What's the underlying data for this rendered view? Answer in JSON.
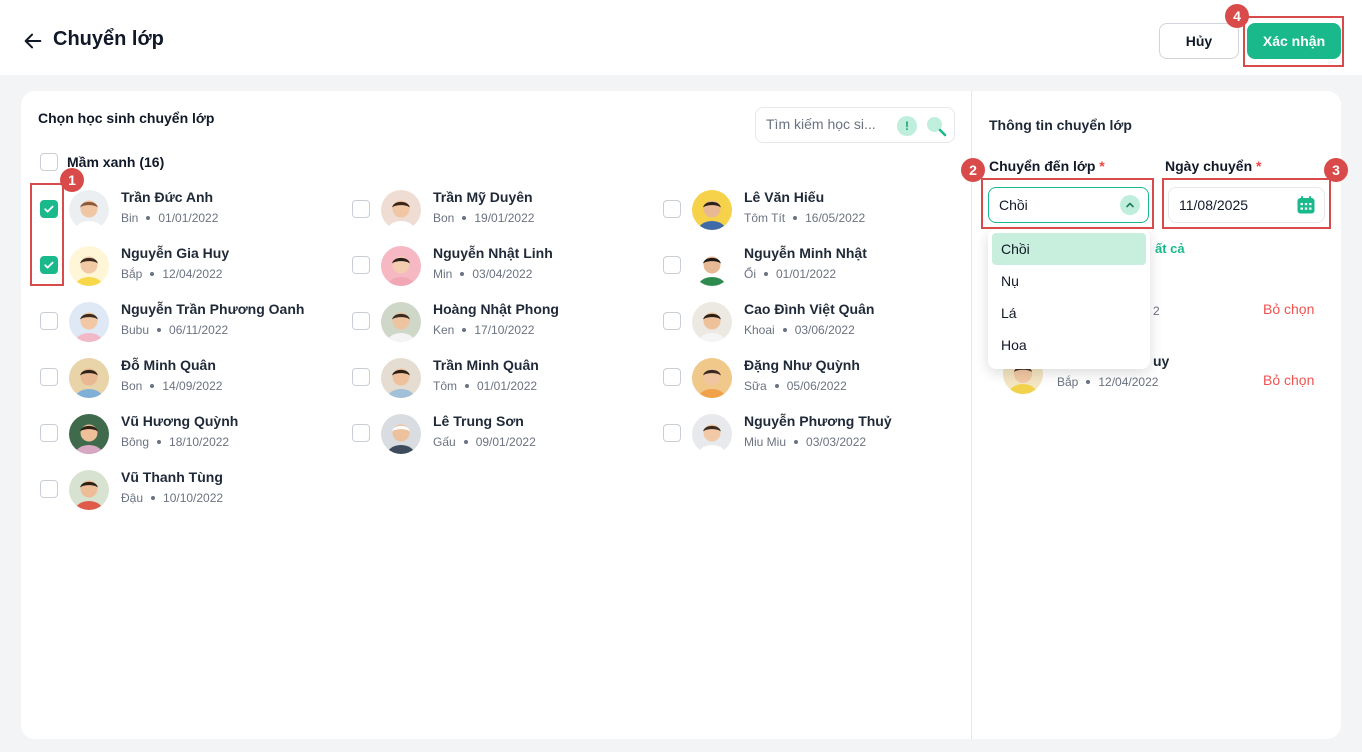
{
  "header": {
    "title": "Chuyển lớp",
    "cancel_label": "Hủy",
    "confirm_label": "Xác nhận"
  },
  "left": {
    "title": "Chọn học sinh chuyển lớp",
    "search_placeholder": "Tìm kiếm học si...",
    "group_label": "Mầm xanh (16)",
    "students": [
      {
        "name": "Trần Đức Anh",
        "nick": "Bin",
        "dob": "01/01/2022",
        "checked": true
      },
      {
        "name": "Nguyễn Gia Huy",
        "nick": "Bắp",
        "dob": "12/04/2022",
        "checked": true
      },
      {
        "name": "Nguyễn Trần Phương Oanh",
        "nick": "Bubu",
        "dob": "06/11/2022",
        "checked": false
      },
      {
        "name": "Đỗ Minh Quân",
        "nick": "Bon",
        "dob": "14/09/2022",
        "checked": false
      },
      {
        "name": "Vũ Hương Quỳnh",
        "nick": "Bông",
        "dob": "18/10/2022",
        "checked": false
      },
      {
        "name": "Vũ Thanh Tùng",
        "nick": "Đậu",
        "dob": "10/10/2022",
        "checked": false
      },
      {
        "name": "Trần Mỹ Duyên",
        "nick": "Bon",
        "dob": "19/01/2022",
        "checked": false
      },
      {
        "name": "Nguyễn Nhật Linh",
        "nick": "Min",
        "dob": "03/04/2022",
        "checked": false
      },
      {
        "name": "Hoàng Nhật Phong",
        "nick": "Ken",
        "dob": "17/10/2022",
        "checked": false
      },
      {
        "name": "Trần Minh Quân",
        "nick": "Tôm",
        "dob": "01/01/2022",
        "checked": false
      },
      {
        "name": "Lê Trung Sơn",
        "nick": "Gấu",
        "dob": "09/01/2022",
        "checked": false
      },
      {
        "name": "Lê Văn Hiếu",
        "nick": "Tôm Tít",
        "dob": "16/05/2022",
        "checked": false
      },
      {
        "name": "Nguyễn Minh Nhật",
        "nick": "Ổi",
        "dob": "01/01/2022",
        "checked": false
      },
      {
        "name": "Cao Đình Việt Quân",
        "nick": "Khoai",
        "dob": "03/06/2022",
        "checked": false
      },
      {
        "name": "Đặng Như Quỳnh",
        "nick": "Sữa",
        "dob": "05/06/2022",
        "checked": false
      },
      {
        "name": "Nguyễn Phương Thuỷ",
        "nick": "Miu Miu",
        "dob": "03/03/2022",
        "checked": false
      }
    ]
  },
  "right": {
    "title": "Thông tin chuyển lớp",
    "class_label": "Chuyển đến lớp",
    "date_label": "Ngày chuyển",
    "required_mark": "*",
    "class_value": "Chồi",
    "date_value": "11/08/2025",
    "select_all_partial": "ất cả",
    "dropdown_options": [
      "Chồi",
      "Nụ",
      "Lá",
      "Hoa"
    ],
    "selected_students": [
      {
        "name_partial": "",
        "meta_partial": "2",
        "remove_label": "Bỏ chọn"
      },
      {
        "name_partial": "uy",
        "nick": "Bắp",
        "dob": "12/04/2022",
        "remove_label": "Bỏ chọn"
      }
    ]
  },
  "callouts": [
    "1",
    "2",
    "3",
    "4"
  ],
  "colors": {
    "accent": "#1ab98c",
    "danger": "#ef5350",
    "callout": "#d94b4b"
  },
  "icons": [
    "back-arrow-icon",
    "info-icon",
    "search-icon",
    "check-icon",
    "chevron-up-icon",
    "calendar-icon"
  ]
}
